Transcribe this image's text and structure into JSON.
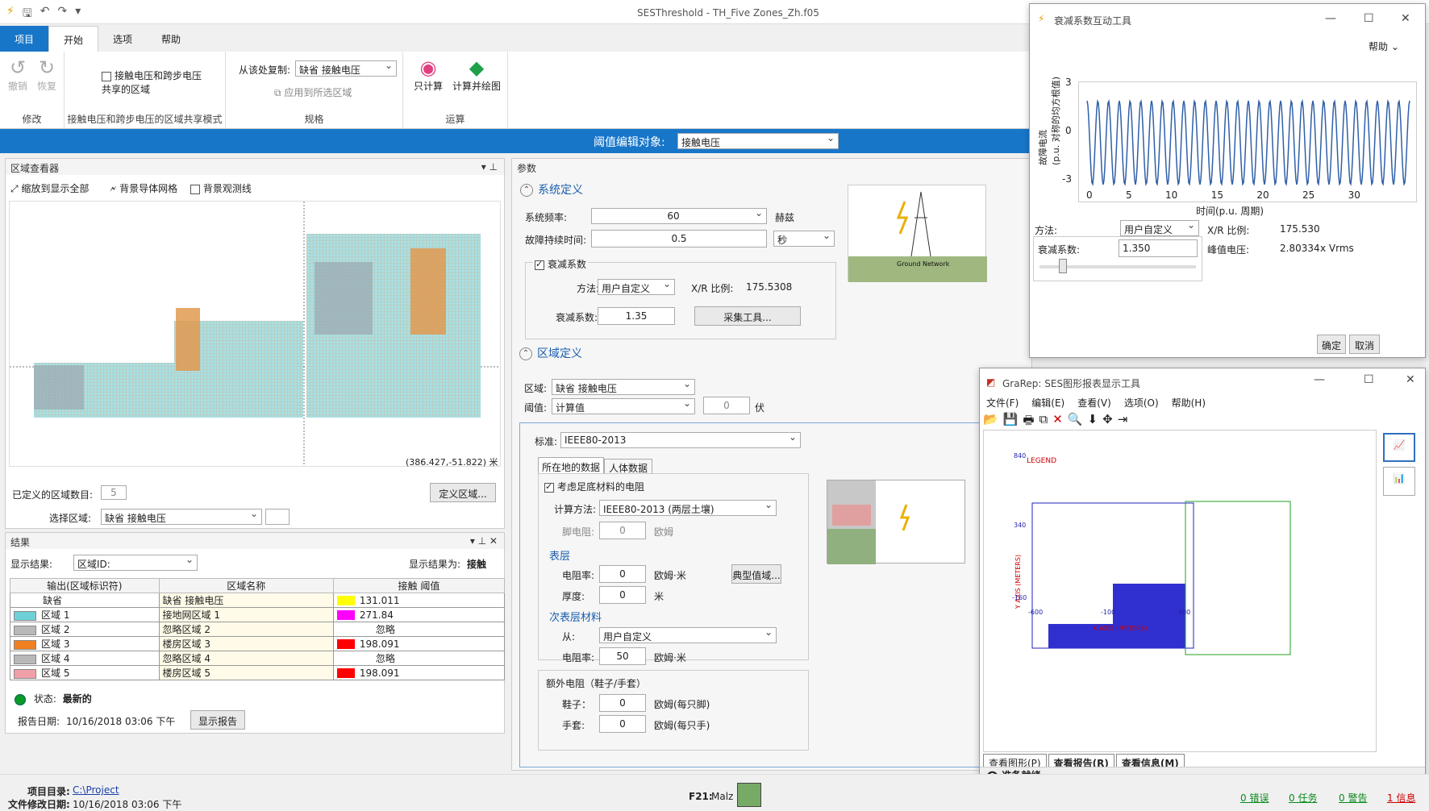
{
  "app": {
    "title": "SESThreshold - TH_Five Zones_Zh.f05"
  },
  "tabs": [
    "项目",
    "开始",
    "选项",
    "帮助"
  ],
  "ribbon": {
    "undo": "撤销",
    "redo": "恢复",
    "modify": "修改",
    "share_check": "接触电压和跨步电压共享的区域",
    "share_group": "接触电压和跨步电压的区域共享模式",
    "copy_from": "从该处复制:",
    "copy_value": "缺省 接触电压",
    "apply_sel": "应用到所选区域",
    "spec": "规格",
    "calc_only": "只计算",
    "calc_plot": "计算并绘图",
    "run": "运算"
  },
  "threshold": {
    "label": "阈值编辑对象:",
    "value": "接触电压"
  },
  "viewer": {
    "title": "区域查看器",
    "zoom": "缩放到显示全部",
    "bg_net": "背景导体网格",
    "bg_line": "背景观测线",
    "coords": "(386.427,-51.822) 米",
    "defined_label": "已定义的区域数目:",
    "defined_value": "5",
    "define_btn": "定义区域...",
    "select_label": "选择区域:",
    "select_value": "缺省 接触电压"
  },
  "results": {
    "title": "结果",
    "show_label": "显示结果:",
    "show_value": "区域ID:",
    "shown_as_label": "显示结果为:",
    "shown_as_value": "接触",
    "headers": [
      "输出(区域标识符)",
      "区域名称",
      "接触 阈值"
    ],
    "rows": [
      {
        "id": "缺省",
        "name": "缺省 接触电压",
        "val": "131.011",
        "sw": "",
        "vc": "#ffff00"
      },
      {
        "id": "区域 1",
        "name": "接地网区域 1",
        "val": "271.84",
        "sw": "#6fd0d8",
        "vc": "#ff00ff"
      },
      {
        "id": "区域 2",
        "name": "忽略区域 2",
        "val": "忽略",
        "sw": "#b8b8b8",
        "vc": ""
      },
      {
        "id": "区域 3",
        "name": "楼房区域 3",
        "val": "198.091",
        "sw": "#f08020",
        "vc": "#ff0000"
      },
      {
        "id": "区域 4",
        "name": "忽略区域 4",
        "val": "忽略",
        "sw": "#b8b8b8",
        "vc": ""
      },
      {
        "id": "区域 5",
        "name": "楼房区域 5",
        "val": "198.091",
        "sw": "#f0a0a8",
        "vc": "#ff0000"
      }
    ],
    "status_label": "状态:",
    "status_value": "最新的",
    "date_label": "报告日期:",
    "date_value": "10/16/2018 03:06 下午",
    "report_btn": "显示报告"
  },
  "params": {
    "title": "参数",
    "sys_def": "系统定义",
    "freq_label": "系统频率:",
    "freq": "60",
    "freq_unit": "赫兹",
    "dur_label": "故障持续时间:",
    "dur": "0.5",
    "dur_unit": "秒",
    "decay_check": "衰减系数",
    "method_label": "方法:",
    "method": "用户自定义",
    "xr_label": "X/R 比例:",
    "xr": "175.5308",
    "decay_label": "衰减系数:",
    "decay": "1.35",
    "collect_btn": "采集工具...",
    "zone_def": "区域定义",
    "zone_label": "区域:",
    "zone": "缺省 接触电压",
    "thr_label": "阈值:",
    "thr": "计算值",
    "thr_val": "0",
    "thr_unit": "伏",
    "std_label": "标准:",
    "std": "IEEE80-2013",
    "tab1": "所在地的数据",
    "tab2": "人体数据",
    "foot_check": "考虑足底材料的电阻",
    "calc_label": "计算方法:",
    "calc": "IEEE80-2013 (两层土壤)",
    "foot_label": "脚电阻:",
    "foot": "0",
    "ohm": "欧姆",
    "surface": "表层",
    "res_label": "电阻率:",
    "res": "0",
    "ohm_m": "欧姆·米",
    "typ_btn": "典型值域...",
    "thick_label": "厚度:",
    "thick": "0",
    "m": "米",
    "sub": "次表层材料",
    "from_label": "从:",
    "from": "用户自定义",
    "subres": "50",
    "extra": "额外电阻（鞋子/手套）",
    "shoe_label": "鞋子：",
    "shoe": "0",
    "shoe_unit": "欧姆(每只脚)",
    "glove_label": "手套:",
    "glove": "0",
    "glove_unit": "欧姆(每只手)"
  },
  "decaytool": {
    "title": "衰减系数互动工具",
    "help": "帮助",
    "ylabel": "故障电流\n(p.u. 对称的均方根值)",
    "xlabel": "时间(p.u. 周期)",
    "yticks": [
      "3",
      "0",
      "-3"
    ],
    "xticks": [
      "0",
      "5",
      "10",
      "15",
      "20",
      "25",
      "30"
    ],
    "method_label": "方法:",
    "method": "用户自定义",
    "xr_label": "X/R 比例:",
    "xr": "175.530",
    "decay_label": "衰减系数:",
    "decay": "1.350",
    "peak_label": "峰值电压:",
    "peak": "2.80334",
    "peak_unit": "x Vrms",
    "ok": "确定",
    "cancel": "取消"
  },
  "grarep": {
    "title": "GraRep: SES图形报表显示工具",
    "menu": [
      "文件(F)",
      "编辑(E)",
      "查看(V)",
      "选项(O)",
      "帮助(H)"
    ],
    "tabs": [
      "查看图形(P)",
      "查看报告(R)",
      "查看信息(M)"
    ],
    "status": "准备就绪",
    "ylabel": "Y AXIS (METERS)",
    "xlabel": "X AXIS (METERS)",
    "yticks": [
      "840",
      "340",
      "-160"
    ],
    "xticks": [
      "-600",
      "-100",
      "400"
    ],
    "legend": "LEGEND"
  },
  "status": {
    "dir_label": "项目目录:",
    "dir": "C:\\Project",
    "mod_label": "文件修改日期:",
    "mod": "10/16/2018 03:06 下午",
    "f21": "F21:",
    "malz": "Malz",
    "errors": "0 错误",
    "tasks": "0 任务",
    "warnings": "0 警告",
    "info": "1 信息"
  }
}
